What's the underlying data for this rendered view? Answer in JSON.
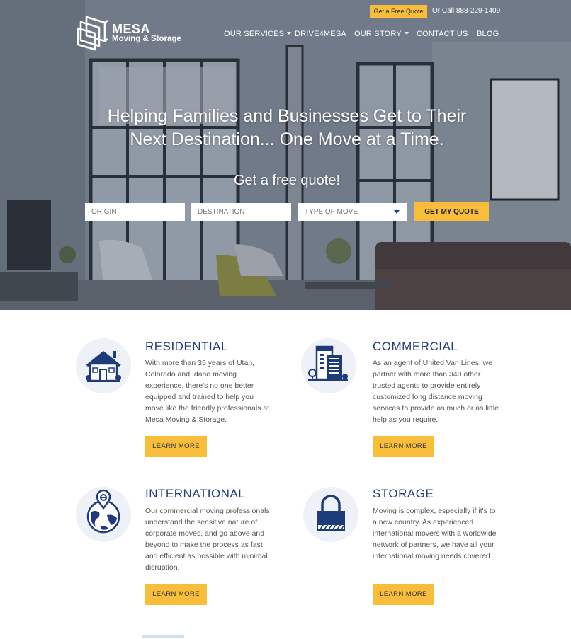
{
  "topbar": {
    "quote_button": "Get a Free Quote",
    "call_text": "Or Call",
    "phone": "888-229-1409"
  },
  "logo": {
    "name": "MESA",
    "subtitle": "Moving & Storage"
  },
  "nav": {
    "items": [
      {
        "label": "OUR SERVICES",
        "dropdown": true
      },
      {
        "label": "DRIVE4MESA",
        "dropdown": false
      },
      {
        "label": "OUR STORY",
        "dropdown": true
      },
      {
        "label": "CONTACT US",
        "dropdown": false
      },
      {
        "label": "BLOG",
        "dropdown": false
      }
    ]
  },
  "hero": {
    "title_line1": "Helping Families and Businesses Get to Their",
    "title_line2": "Next Destination... One Move at a Time.",
    "subtitle": "Get a free quote!",
    "origin_placeholder": "ORIGIN",
    "destination_placeholder": "DESTINATION",
    "move_type_label": "TYPE OF MOVE",
    "submit_label": "GET MY QUOTE"
  },
  "services": [
    {
      "title": "RESIDENTIAL",
      "icon": "house-icon",
      "text": "With more than 35 years of Utah, Colorado and Idaho moving experience, there's no one better equipped and trained to help you move like the friendly professionals at Mesa Moving & Storage.",
      "button": "LEARN MORE"
    },
    {
      "title": "COMMERCIAL",
      "icon": "office-building-icon",
      "text": "As an agent of United Van Lines, we partner with more than 340 other trusted agents to provide entirely customized long distance moving services to provide as much or as little help as you require.",
      "button": "LEARN MORE"
    },
    {
      "title": "INTERNATIONAL",
      "icon": "globe-pin-icon",
      "text": "Our commercial moving professionals understand the sensitive nature of corporate moves, and go above and beyond to make the process as fast and efficient as possible with minimal disruption.",
      "button": "LEARN MORE"
    },
    {
      "title": "STORAGE",
      "icon": "padlock-icon",
      "text": "Moving is complex, especially if it's to a new country. As experienced international movers with a worldwide network of partners, we have all your international moving needs covered.",
      "button": "LEARN MORE"
    }
  ],
  "colors": {
    "accent": "#f7bd3b",
    "brand_blue": "#1f3c7a",
    "icon_bg": "#eef2f8"
  }
}
